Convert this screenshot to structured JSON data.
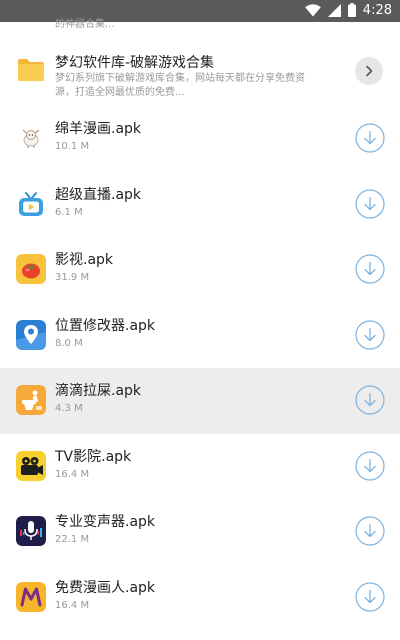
{
  "status_bar": {
    "time": "4:28",
    "icons": [
      "wifi-icon",
      "signal-icon",
      "battery-icon"
    ]
  },
  "top_snippet": "的神器合集...",
  "folder": {
    "title": "梦幻软件库-破解游戏合集",
    "description": "梦幻系列旗下破解游戏库合集，网站每天都在分享免费资源，打造全网最优质的免费...",
    "icon": "folder-icon",
    "action_icon": "chevron-right-icon"
  },
  "apps": [
    {
      "name": "绵羊漫画.apk",
      "size": "10.1 M",
      "icon": "sheep-icon",
      "highlighted": false
    },
    {
      "name": "超级直播.apk",
      "size": "6.1 M",
      "icon": "tv-icon",
      "highlighted": false
    },
    {
      "name": "影视.apk",
      "size": "31.9 M",
      "icon": "tomato-icon",
      "highlighted": false
    },
    {
      "name": "位置修改器.apk",
      "size": "8.0 M",
      "icon": "map-pin-icon",
      "highlighted": false
    },
    {
      "name": "滴滴拉屎.apk",
      "size": "4.3 M",
      "icon": "toilet-icon",
      "highlighted": true
    },
    {
      "name": "TV影院.apk",
      "size": "16.4 M",
      "icon": "film-camera-icon",
      "highlighted": false
    },
    {
      "name": "专业变声器.apk",
      "size": "22.1 M",
      "icon": "microphone-icon",
      "highlighted": false
    },
    {
      "name": "免费漫画人.apk",
      "size": "16.4 M",
      "icon": "comic-m-icon",
      "highlighted": false
    }
  ],
  "colors": {
    "status_bar": "#5a5a5a",
    "download_accent": "#7fb3de",
    "folder_yellow": "#f7c844",
    "highlight_row": "#ededed"
  }
}
